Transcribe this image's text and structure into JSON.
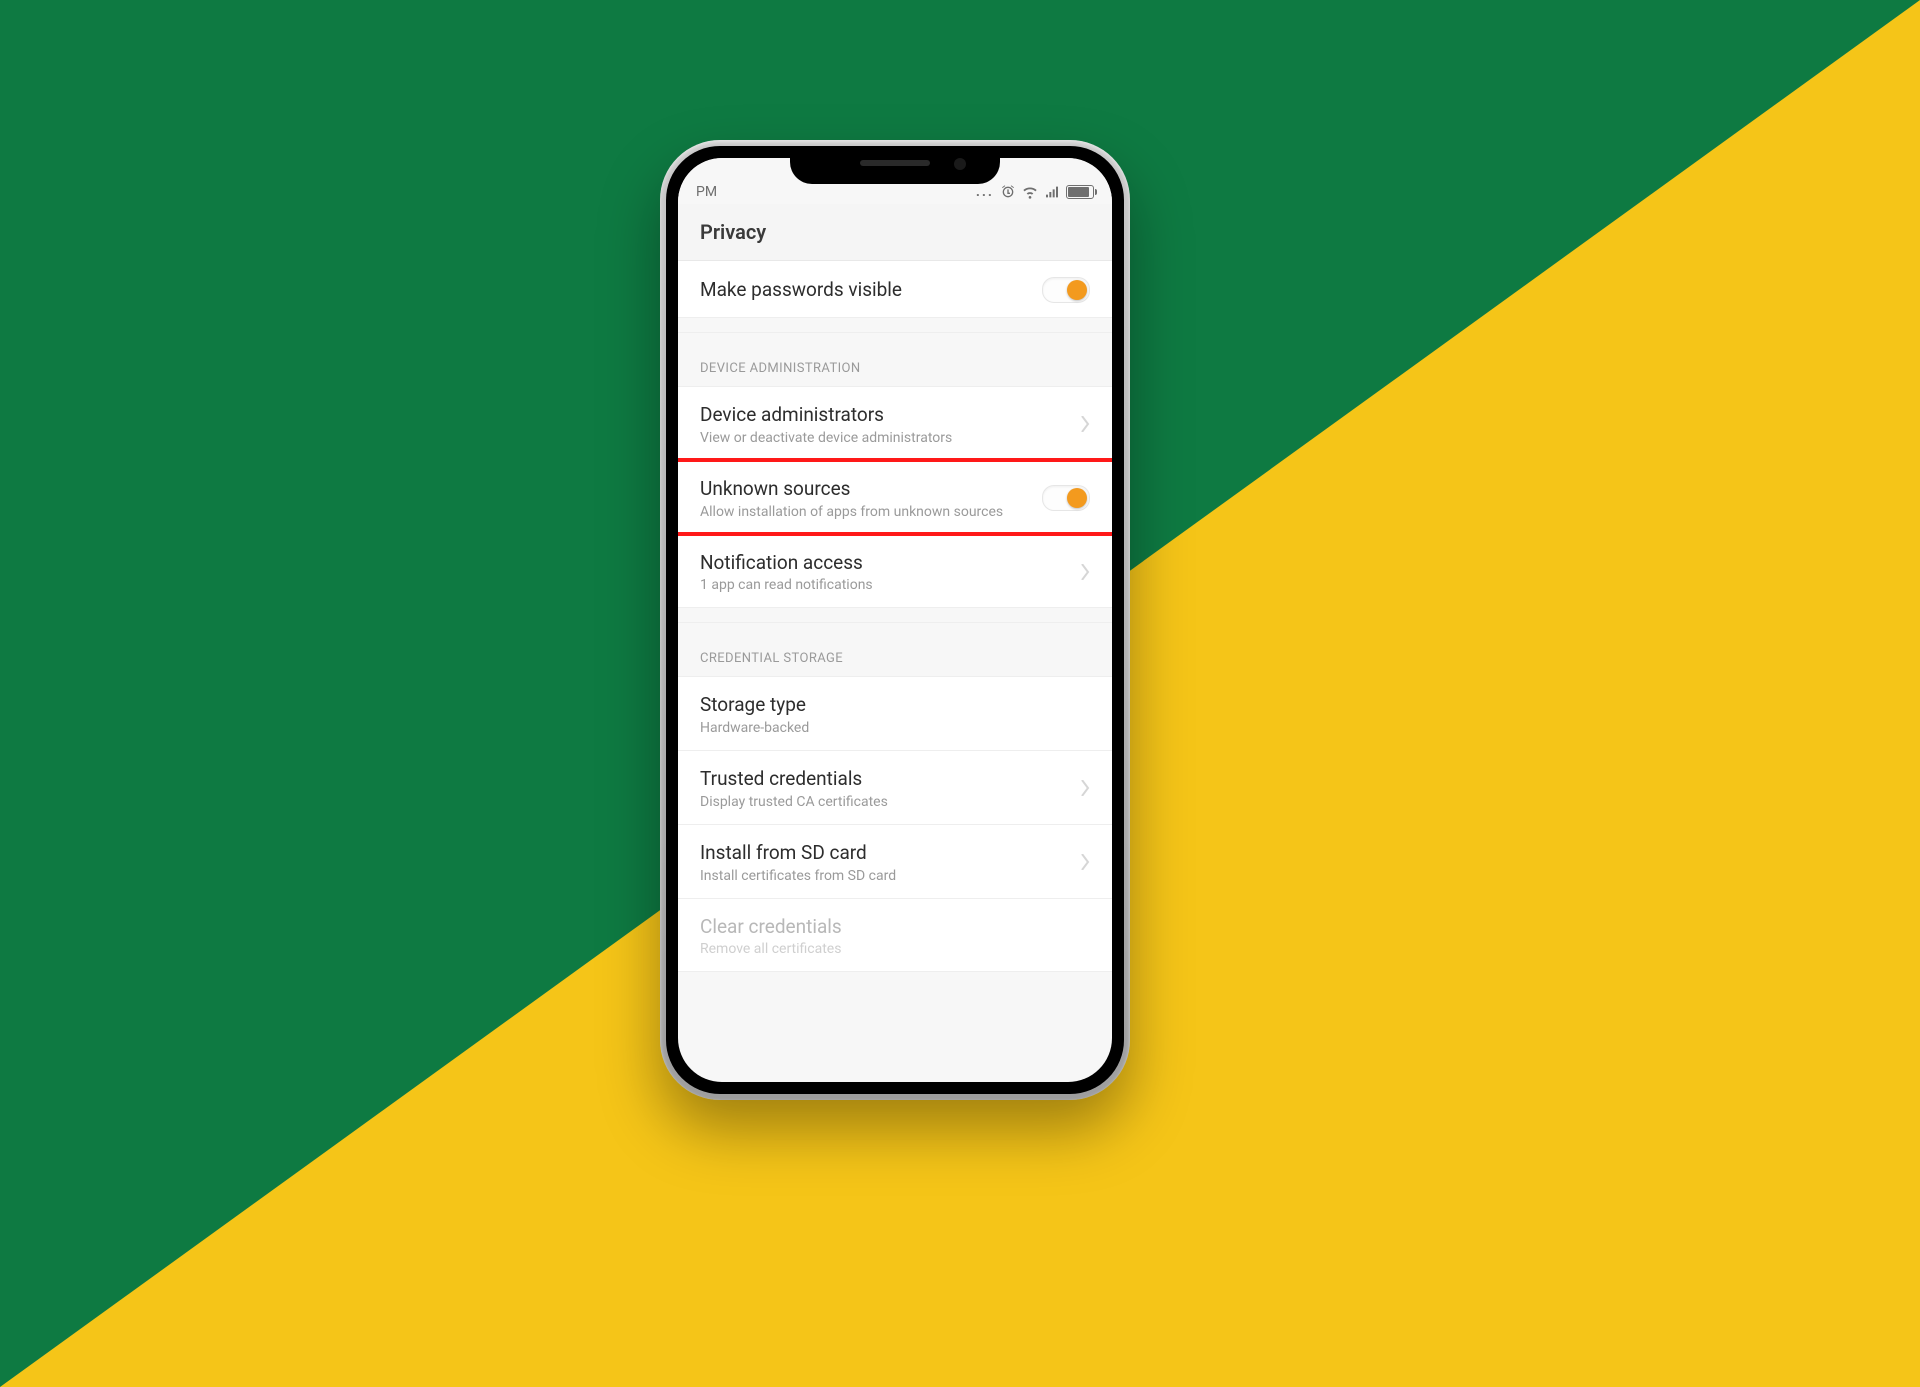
{
  "background": {
    "green": "#0e7a42",
    "yellow": "#f5c518"
  },
  "statusbar": {
    "time": "PM",
    "icons": [
      "ellipsis",
      "alarm",
      "wifi",
      "signal",
      "battery"
    ]
  },
  "header": {
    "title": "Privacy"
  },
  "rows": {
    "passwords": {
      "title": "Make passwords visible",
      "toggle_on": true
    },
    "section_admin": {
      "label": "DEVICE ADMINISTRATION"
    },
    "device_admin": {
      "title": "Device administrators",
      "sub": "View or deactivate device administrators"
    },
    "unknown": {
      "title": "Unknown sources",
      "sub": "Allow installation of apps from unknown sources",
      "toggle_on": true
    },
    "notif": {
      "title": "Notification access",
      "sub": "1 app can read notifications"
    },
    "section_cred": {
      "label": "CREDENTIAL STORAGE"
    },
    "storage": {
      "title": "Storage type",
      "sub": "Hardware-backed"
    },
    "trusted": {
      "title": "Trusted credentials",
      "sub": "Display trusted CA certificates"
    },
    "install_sd": {
      "title": "Install from SD card",
      "sub": "Install certificates from SD card"
    },
    "clear": {
      "title": "Clear credentials",
      "sub": "Remove all certificates"
    }
  },
  "highlight_color": "#ff0000"
}
